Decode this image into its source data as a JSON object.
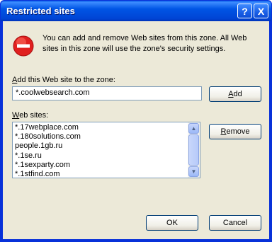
{
  "window": {
    "title": "Restricted sites"
  },
  "titlebar_buttons": {
    "help": "?",
    "close": "X"
  },
  "message": "You can add and remove Web sites from this zone. All Web sites in this zone will use the zone's security settings.",
  "add_section": {
    "label_accel": "A",
    "label_rest": "dd this Web site to the zone:",
    "input_value": "*.coolwebsearch.com",
    "add_button_accel": "A",
    "add_button_rest": "dd"
  },
  "sites_section": {
    "label_accel": "W",
    "label_rest": "eb sites:",
    "items": [
      "*.17webplace.com",
      "*.180solutions.com",
      "people.1gb.ru",
      "*.1se.ru",
      "*.1sexparty.com",
      "*.1stfind.com"
    ],
    "remove_button_accel": "R",
    "remove_button_rest": "emove"
  },
  "footer": {
    "ok": "OK",
    "cancel": "Cancel"
  },
  "colors": {
    "titlebar": "#0055e5",
    "client": "#ece9d8",
    "stop_icon": "#e0201f"
  },
  "icons": {
    "stop": "stop-icon",
    "scroll_up": "scroll-up-icon",
    "scroll_down": "scroll-down-icon"
  }
}
